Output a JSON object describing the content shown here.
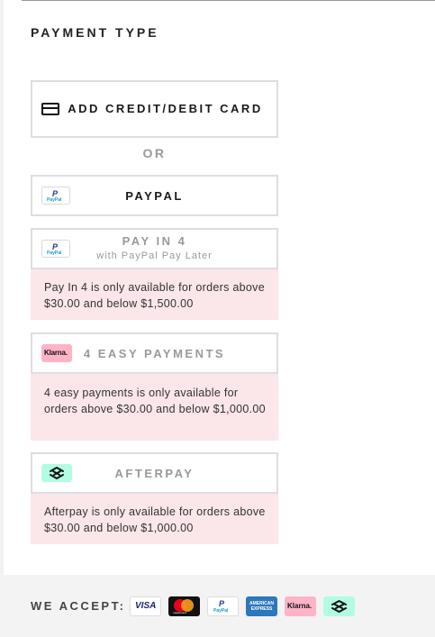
{
  "section_title": "PAYMENT TYPE",
  "or_text": "OR",
  "options": {
    "card": {
      "label": "ADD CREDIT/DEBIT CARD",
      "icon": "credit-card-icon"
    },
    "paypal": {
      "label": "PAYPAL",
      "icon": "paypal-icon",
      "badge_letter": "P",
      "badge_word": "PayPal"
    },
    "pay_in_4": {
      "label": "PAY IN 4",
      "sublabel": "with PayPal Pay Later",
      "icon": "paypal-icon",
      "badge_letter": "P",
      "badge_word": "PayPal",
      "message": "Pay In 4 is only available for orders above $30.00 and below $1,500.00"
    },
    "klarna": {
      "label": "4 EASY PAYMENTS",
      "icon": "klarna-icon",
      "badge_text": "Klarna.",
      "message": "4 easy payments is only available for orders above $30.00 and below $1,000.00"
    },
    "afterpay": {
      "label": "AFTERPAY",
      "icon": "afterpay-icon",
      "message": "Afterpay is only available for orders above $30.00 and below $1,000.00"
    }
  },
  "footer": {
    "we_accept": "WE ACCEPT:",
    "logos": {
      "visa": "VISA",
      "mastercard": "mastercard",
      "paypal_letter": "P",
      "paypal_word": "PayPal",
      "amex": "AMERICAN EXPRESS",
      "klarna": "Klarna."
    }
  },
  "colors": {
    "message_bg": "#fbe6ea",
    "klarna_pink": "#ffb3c7",
    "afterpay_mint": "#b2fce4",
    "border": "#dedede",
    "disabled_text": "#999999"
  }
}
